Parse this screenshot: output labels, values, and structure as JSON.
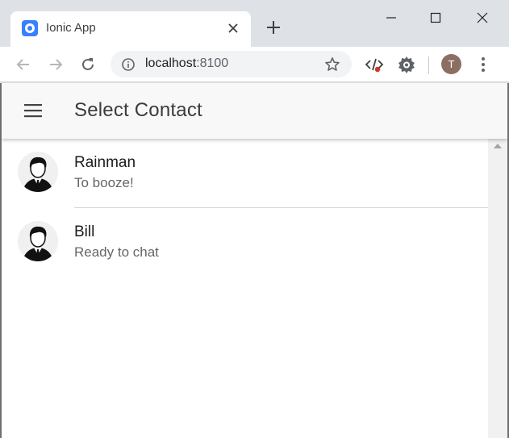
{
  "browser": {
    "tab_title": "Ionic App",
    "url_host": "localhost",
    "url_port": ":8100",
    "profile_initial": "T"
  },
  "header": {
    "title": "Select Contact"
  },
  "contacts": [
    {
      "name": "Rainman",
      "status": "To booze!",
      "avatar": "businessman-avatar"
    },
    {
      "name": "Bill",
      "status": "Ready to chat",
      "avatar": "businessman-avatar"
    }
  ],
  "colors": {
    "ionic_blue": "#3880ff",
    "header_bg": "#f8f8f8",
    "profile_bg": "#8d6e63"
  }
}
